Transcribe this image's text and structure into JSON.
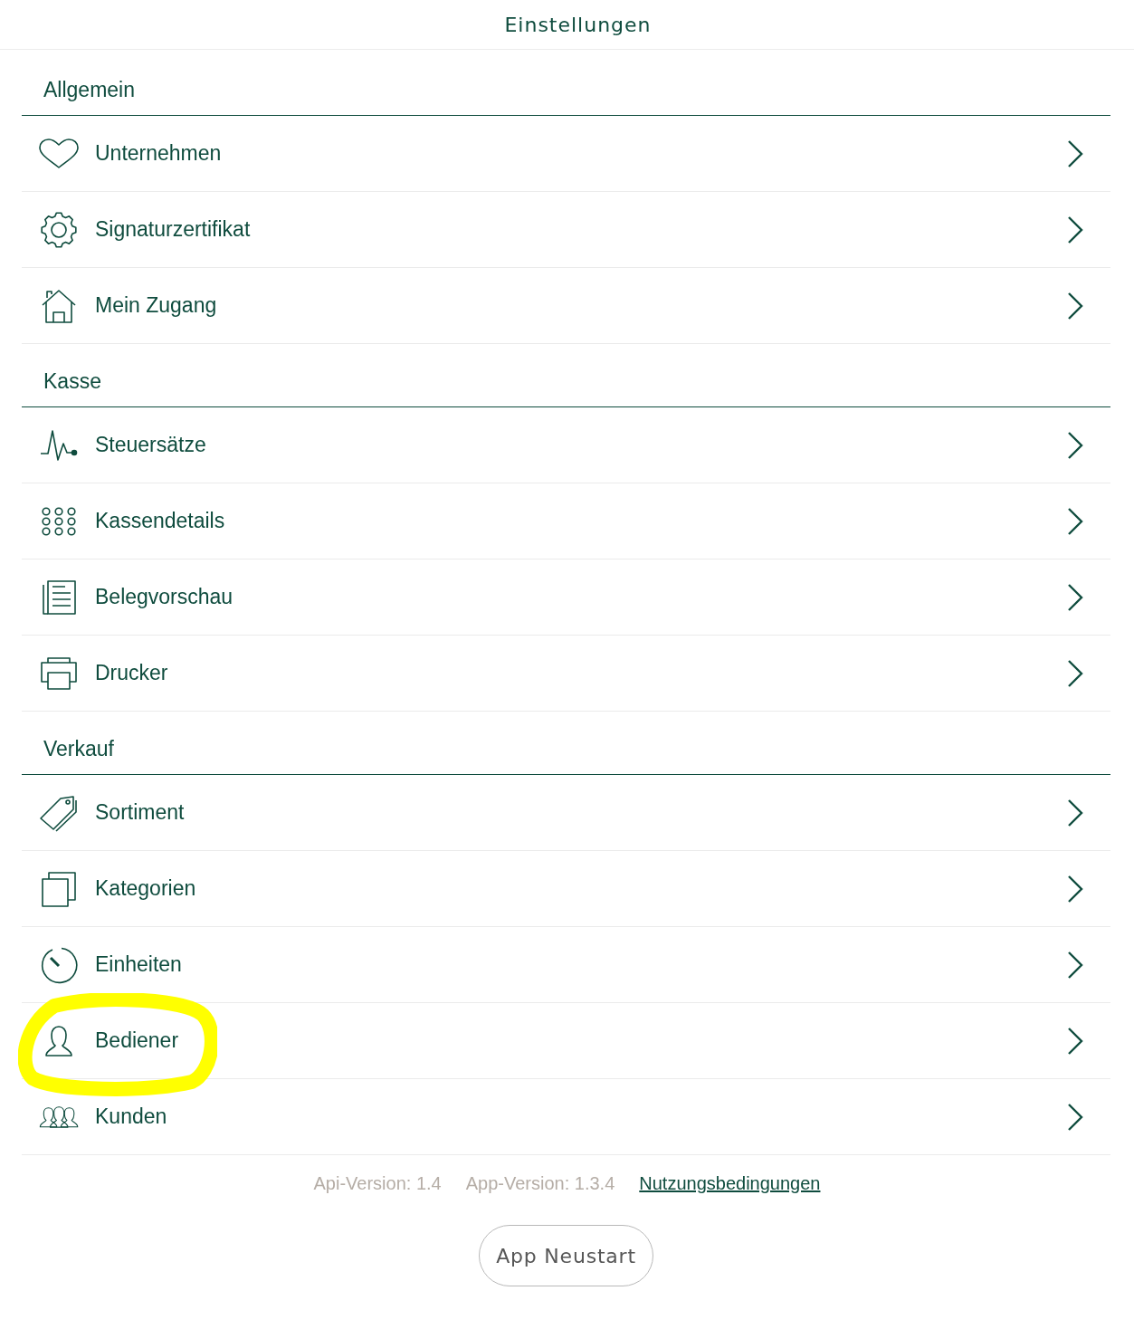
{
  "header": {
    "title": "Einstellungen"
  },
  "sections": [
    {
      "title": "Allgemein",
      "items": [
        {
          "label": "Unternehmen",
          "highlighted": false
        },
        {
          "label": "Signaturzertifikat",
          "highlighted": false
        },
        {
          "label": "Mein Zugang",
          "highlighted": false
        }
      ]
    },
    {
      "title": "Kasse",
      "items": [
        {
          "label": "Steuersätze",
          "highlighted": false
        },
        {
          "label": "Kassendetails",
          "highlighted": false
        },
        {
          "label": "Belegvorschau",
          "highlighted": false
        },
        {
          "label": "Drucker",
          "highlighted": false
        }
      ]
    },
    {
      "title": "Verkauf",
      "items": [
        {
          "label": "Sortiment",
          "highlighted": false
        },
        {
          "label": "Kategorien",
          "highlighted": false
        },
        {
          "label": "Einheiten",
          "highlighted": false
        },
        {
          "label": "Bediener",
          "highlighted": true
        },
        {
          "label": "Kunden",
          "highlighted": false
        }
      ]
    }
  ],
  "footer": {
    "api_version": "Api-Version: 1.4",
    "app_version": "App-Version: 1.3.4",
    "terms_link": "Nutzungsbedingungen"
  },
  "restart_button": {
    "label": "App Neustart"
  }
}
